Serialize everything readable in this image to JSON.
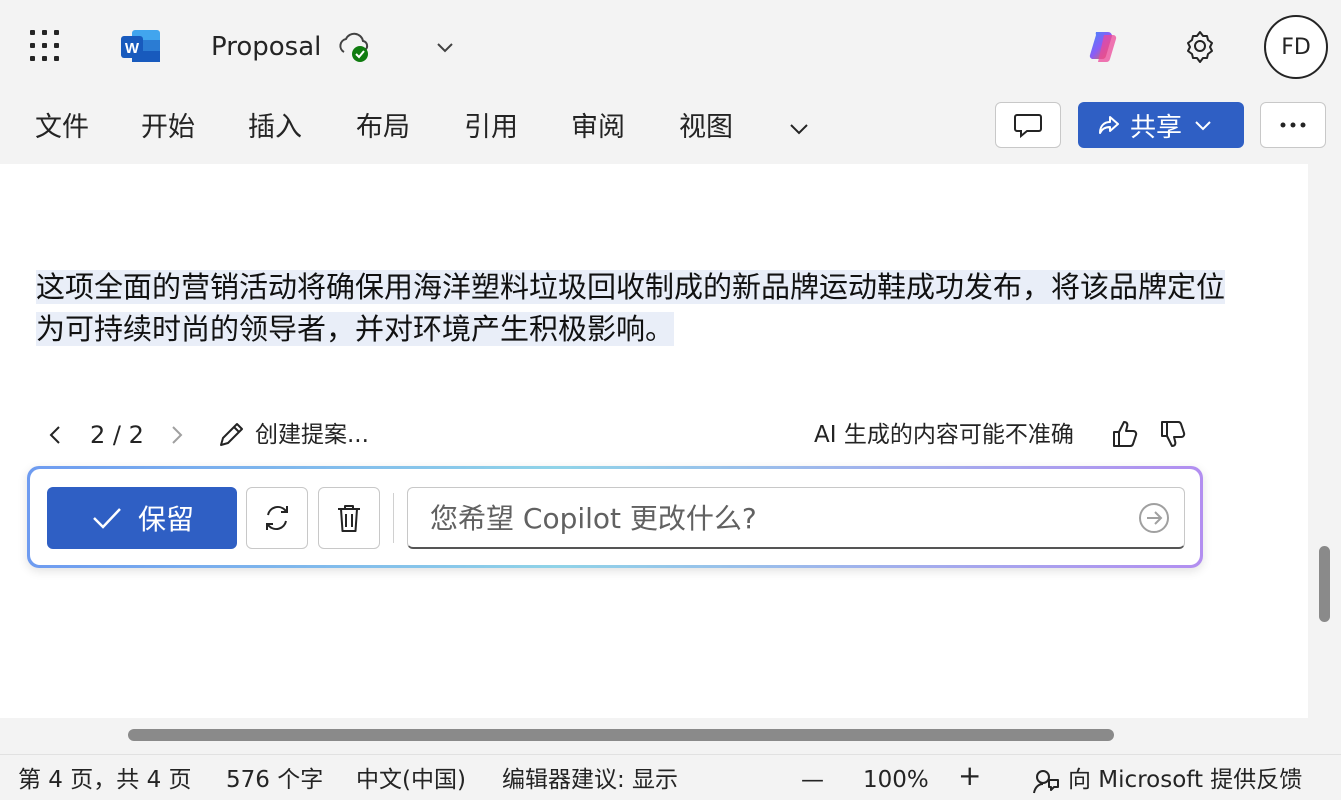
{
  "app": {
    "document_title": "Proposal",
    "icons": [
      "app-launcher-icon",
      "word-logo-icon",
      "cloud-saved-icon",
      "chevron-down-icon",
      "copilot-icon",
      "gear-icon"
    ]
  },
  "user": {
    "initials": "FD"
  },
  "ribbon": {
    "tabs": [
      "文件",
      "开始",
      "插入",
      "布局",
      "引用",
      "审阅",
      "视图"
    ],
    "share_label": "共享"
  },
  "document": {
    "paragraph": "这项全面的营销活动将确保用海洋塑料垃圾回收制成的新品牌运动鞋成功发布，将该品牌定位为可持续时尚的领导者，并对环境产生积极影响。"
  },
  "copilot": {
    "nav_count": "2 / 2",
    "create_label": "创建提案...",
    "ai_disclaimer": "AI 生成的内容可能不准确",
    "keep_label": "保留",
    "prompt_placeholder": "您希望 Copilot 更改什么?"
  },
  "status_bar": {
    "page_info": "第 4 页，共 4 页",
    "word_count": "576 个字",
    "language": "中文(中国)",
    "editor_suggestions": "编辑器建议: 显示",
    "zoom_out": "—",
    "zoom": "100%",
    "zoom_in": "+",
    "feedback": "向 Microsoft 提供反馈"
  },
  "colors": {
    "accent": "#2f5fc4",
    "highlight": "#e9eef8",
    "chrome_bg": "#f3f3f3"
  }
}
